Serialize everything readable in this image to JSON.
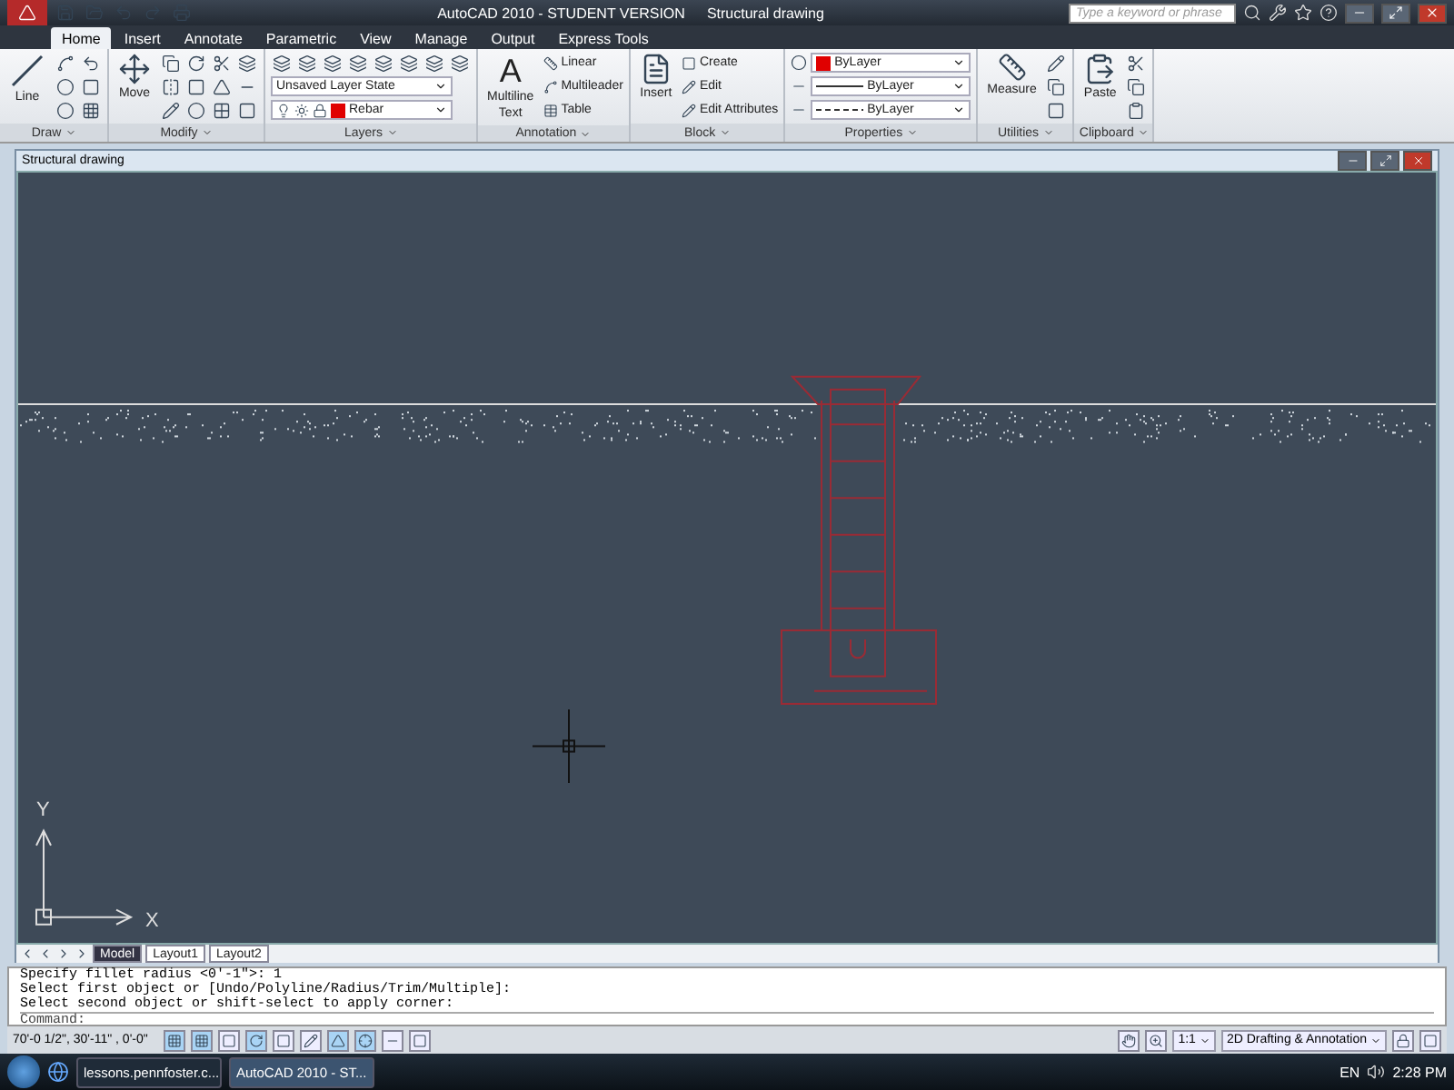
{
  "title_bar": {
    "app": "AutoCAD 2010 - STUDENT VERSION",
    "document": "Structural drawing",
    "search": {
      "placeholder": "Type a keyword or phrase"
    }
  },
  "tabs": [
    {
      "label": "Home",
      "selected": true
    },
    {
      "label": "Insert",
      "selected": false
    },
    {
      "label": "Annotate",
      "selected": false
    },
    {
      "label": "Parametric",
      "selected": false
    },
    {
      "label": "View",
      "selected": false
    },
    {
      "label": "Manage",
      "selected": false
    },
    {
      "label": "Output",
      "selected": false
    },
    {
      "label": "Express Tools",
      "selected": false
    }
  ],
  "ribbon": {
    "draw": {
      "title": "Draw",
      "line": "Line"
    },
    "modify": {
      "title": "Modify",
      "move": "Move"
    },
    "layers": {
      "title": "Layers",
      "layer_state": "Unsaved Layer State",
      "layer": "Rebar"
    },
    "annotation": {
      "title": "Annotation",
      "glyph": "A",
      "text_tool": "Multiline",
      "text_tool_2": "Text",
      "linear": "Linear",
      "multileader": "Multileader",
      "table": "Table"
    },
    "block": {
      "title": "Block",
      "insert": "Insert",
      "create": "Create",
      "edit": "Edit",
      "edit_attributes": "Edit Attributes"
    },
    "properties": {
      "title": "Properties",
      "color_label": "ByLayer",
      "linetype": "ByLayer",
      "lineweight": "ByLayer"
    },
    "utilities": {
      "title": "Utilities",
      "measure": "Measure"
    },
    "clipboard": {
      "title": "Clipboard",
      "paste": "Paste"
    }
  },
  "document": {
    "title": "Structural drawing",
    "ucs": {
      "x": "X",
      "y": "Y"
    },
    "layout_tabs": [
      {
        "label": "Model",
        "selected": true
      },
      {
        "label": "Layout1",
        "selected": false
      },
      {
        "label": "Layout2",
        "selected": false
      }
    ]
  },
  "command": {
    "history": [
      "Specify fillet radius <0'-1\">: 1",
      "Select first object or [Undo/Polyline/Radius/Trim/Multiple]:",
      "Select second object or shift-select to apply corner:"
    ],
    "prompt": "Command:"
  },
  "status_bar": {
    "coordinates": "70'-0 1/2\", 30'-11\" , 0'-0\"",
    "toggles": [
      {
        "on": true
      },
      {
        "on": true
      },
      {
        "on": false
      },
      {
        "on": true
      },
      {
        "on": false
      },
      {
        "on": false
      },
      {
        "on": true
      },
      {
        "on": true
      },
      {
        "on": false
      },
      {
        "on": false
      }
    ],
    "scale": "1:1",
    "workspace": "2D Drafting & Annotation"
  },
  "taskbar": {
    "items": [
      {
        "label": "lessons.pennfoster.c...",
        "selected": false
      },
      {
        "label": "AutoCAD 2010 - ST...",
        "selected": true
      }
    ],
    "language": "EN",
    "time": "2:28 PM"
  }
}
